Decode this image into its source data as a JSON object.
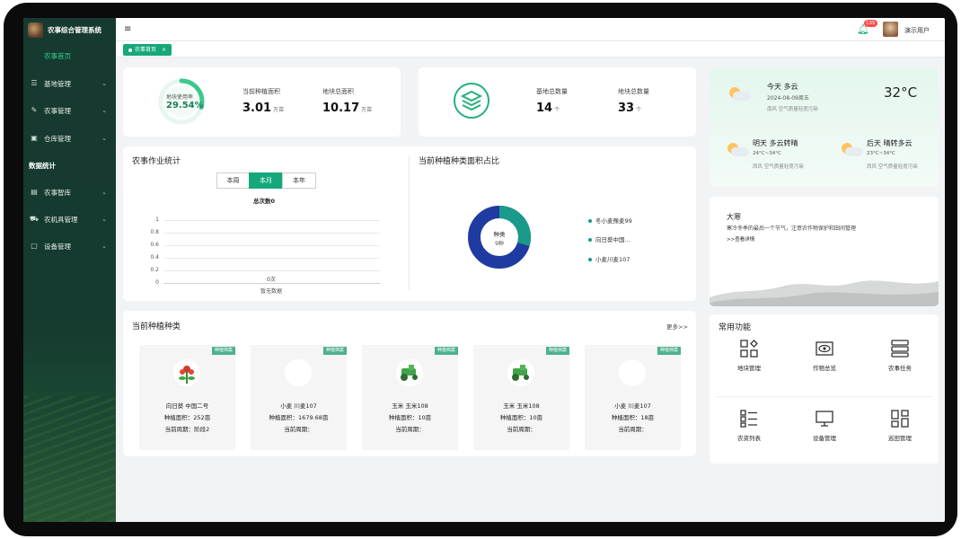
{
  "app": {
    "title": "农事综合管理系统"
  },
  "sidebar": {
    "items": [
      {
        "label": "农事首页",
        "icon": "home-icon",
        "active": true
      },
      {
        "label": "基地管理",
        "icon": "sliders-icon",
        "expandable": true
      },
      {
        "label": "农事管理",
        "icon": "edit-doc-icon",
        "expandable": true
      },
      {
        "label": "仓库管理",
        "icon": "warehouse-icon",
        "expandable": true
      }
    ],
    "section_label": "数据统计",
    "items2": [
      {
        "label": "农事智库",
        "icon": "book-icon",
        "expandable": true
      },
      {
        "label": "农机具管理",
        "icon": "tractor-icon",
        "expandable": true
      },
      {
        "label": "设备管理",
        "icon": "device-icon",
        "expandable": true
      }
    ]
  },
  "header": {
    "notification_count": "135",
    "user_name": "演示用户"
  },
  "tabs": [
    {
      "label": "农事首页",
      "close": "×"
    }
  ],
  "overview": {
    "usage_label": "地块使用率",
    "usage_value": "29.54%",
    "usage_fraction": 0.2954,
    "planting_area_label": "当前种植面积",
    "planting_area_value": "3.01",
    "planting_area_unit": "万亩",
    "plot_area_label": "地块总面积",
    "plot_area_value": "10.17",
    "plot_area_unit": "万亩"
  },
  "base_stats": {
    "base_count_label": "基地总数量",
    "base_count_value": "14",
    "base_count_unit": "个",
    "plot_count_label": "地块总数量",
    "plot_count_value": "33",
    "plot_count_unit": "个"
  },
  "weather": {
    "today_label": "今天 多云",
    "today_date": "2024-08-09周五",
    "today_wind": "南风 空气质量轻度污染",
    "today_temp": "32°C",
    "tomorrow_label": "明天 多云转晴",
    "tomorrow_range": "24°C~34°C",
    "tomorrow_wind": "西风 空气质量轻度污染",
    "after_label": "后天 晴转多云",
    "after_range": "23°C~34°C",
    "after_wind": "西风 空气质量轻度污染"
  },
  "solar_term": {
    "title": "大寒",
    "text": "寒冷冬季的最后一个节气，注意农作物保护和田间管理",
    "link": ">>查看详情"
  },
  "work_stats": {
    "title": "农事作业统计",
    "periods": [
      "本周",
      "本月",
      "本年"
    ],
    "active_period": "本月",
    "total_label": "总次数0",
    "y_ticks": [
      "1",
      "0.8",
      "0.6",
      "0.4",
      "0.2",
      "0"
    ],
    "bar_label": "0次",
    "empty_label": "暂无数据"
  },
  "crop_share": {
    "title": "当前种植种类面积占比",
    "center_title": "种类",
    "center_value": "9种",
    "legend": [
      "冬小麦豫麦99",
      "向日葵中国…",
      "小麦川麦107"
    ],
    "colors": {
      "dark": "#1f3aa0",
      "teal": "#1a9a8a"
    }
  },
  "chart_data": {
    "type": "bar",
    "title": "农事作业统计",
    "categories": [
      ""
    ],
    "values": [
      0
    ],
    "ylim": [
      0,
      1
    ],
    "yticks": [
      0,
      0.2,
      0.4,
      0.6,
      0.8,
      1
    ]
  },
  "crops": {
    "title": "当前种植种类",
    "more": "更多>>",
    "ribbon": "种植档案",
    "items": [
      {
        "name": "向日葵 中国二号",
        "area": "种植面积：252亩",
        "period": "当前周期：阶段2",
        "pic": "sunflower-icon"
      },
      {
        "name": "小麦 川麦107",
        "area": "种植面积：1679.68亩",
        "period": "当前周期：",
        "pic": "blank-icon"
      },
      {
        "name": "玉米 玉米108",
        "area": "种植面积：10亩",
        "period": "当前周期：",
        "pic": "tractor-icon"
      },
      {
        "name": "玉米 玉米108",
        "area": "种植面积：10亩",
        "period": "当前周期：",
        "pic": "tractor-icon"
      },
      {
        "name": "小麦 川麦107",
        "area": "种植面积：18亩",
        "period": "当前周期：",
        "pic": "blank-icon"
      }
    ]
  },
  "functions": {
    "title": "常用功能",
    "items": [
      {
        "label": "地块管理",
        "icon": "grid-plot-icon"
      },
      {
        "label": "作物总览",
        "icon": "eye-icon"
      },
      {
        "label": "农事任务",
        "icon": "task-list-icon"
      },
      {
        "label": "农资列表",
        "icon": "list-icon"
      },
      {
        "label": "设备管理",
        "icon": "monitor-icon"
      },
      {
        "label": "巡田管理",
        "icon": "tiles-icon"
      }
    ]
  }
}
